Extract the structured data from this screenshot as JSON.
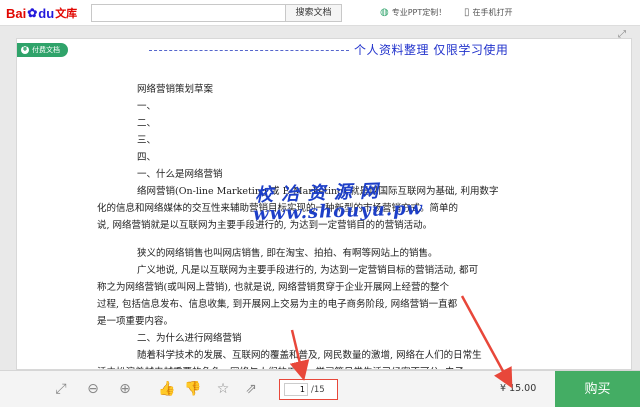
{
  "header": {
    "logo": {
      "bai": "Bai",
      "du": "du",
      "wenku": "文库"
    },
    "search": {
      "placeholder": "",
      "button_label": "搜索文档"
    },
    "ppt_link": "专业PPT定制！",
    "mobile_link": "在手机打开"
  },
  "document": {
    "paid_badge": "付费文档",
    "watermark_top": "个人资料整理  仅限学习使用",
    "watermark_center": "校 冶 资 源 网",
    "watermark_url": "www.shouyu.pw",
    "lines": [
      {
        "text": "网络营销策划草案",
        "style": "ind"
      },
      {
        "text": "一、",
        "style": "ind"
      },
      {
        "text": "二、",
        "style": "ind"
      },
      {
        "text": "三、",
        "style": "ind"
      },
      {
        "text": "四、",
        "style": "ind"
      },
      {
        "text": "一、什么是网络营销",
        "style": "ind"
      },
      {
        "text": "络网营销(On-line Marketing 或 E-Marketing) 就是以国际互联网为基础, 利用数字",
        "style": "ind"
      },
      {
        "text": "化的信息和网络媒体的交互性来辅助营销目标实现的一种新型的市场营销方式。简单的",
        "style": "wrapline"
      },
      {
        "text": "说, 网络营销就是以互联网为主要手段进行的, 为达到一定营销目的的营销活动。",
        "style": "wrapline"
      },
      {
        "text": "",
        "style": "gap"
      },
      {
        "text": "狭义的网络销售也叫网店销售, 即在淘宝、拍拍、有啊等网站上的销售。",
        "style": "ind"
      },
      {
        "text": "广义地说, 凡是以互联网为主要手段进行的, 为达到一定营销目标的营销活动, 都可",
        "style": "ind"
      },
      {
        "text": "称之为网络营销(或叫网上营销), 也就是说, 网络营销贯穿于企业开展网上经营的整个",
        "style": "wrapline"
      },
      {
        "text": "过程, 包括信息发布、信息收集, 到开展网上交易为主的电子商务阶段, 网络营销一直都",
        "style": "wrapline"
      },
      {
        "text": "是一项重要内容。",
        "style": "wrapline"
      },
      {
        "text": "二、为什么进行网络营销",
        "style": "ind"
      },
      {
        "text": "随着科学技术的发展、互联网的覆盖和普及, 网民数量的激增, 网络在人们的日常生",
        "style": "ind"
      },
      {
        "text": "活中扮演着越来越重要的角色。网络与人们的工作、学习等日常生活已经密不可分, 电子",
        "style": "wrapline"
      }
    ]
  },
  "toolbar": {
    "current_page": "1",
    "total_pages": "/15",
    "price": "¥ 15.00",
    "buy_label": "购买"
  }
}
